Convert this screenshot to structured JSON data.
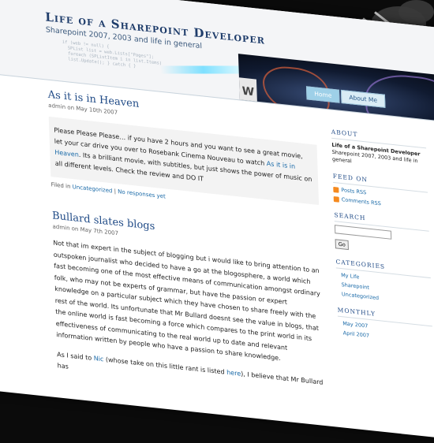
{
  "blog": {
    "title": "Life of a Sharepoint Developer",
    "subtitle": "Sharepoint 2007, 2003 and life in general"
  },
  "nav": {
    "home": "Home",
    "about": "About Me"
  },
  "posts": [
    {
      "title": "As it is in Heaven",
      "meta": "admin on May 10th 2007",
      "body_pre": "Please Please Please… if you have 2 hours and you want to see a great movie, let your car drive you over to Rosebank Cinema Nouveau to watch ",
      "body_link": "As it is in Heaven",
      "body_post": ". Its a brilliant movie, with subtitles, but just shows the power of music on all different levels. Check the review and DO IT",
      "filed_prefix": "Filed in",
      "filed_cat": "Uncategorized",
      "filed_sep": "|",
      "responses": "No responses yet"
    },
    {
      "title": "Bullard slates blogs",
      "meta": "admin on May 7th 2007",
      "para1": "Not that im expert in the subject of blogging but i would like to bring attention to an outspoken journalist who decided to have a go at the blogosphere, a world which fast becoming one of the most effective means of communication amongst ordinary folk, who may not be experts of grammar, but have the passion or expert knowledge on a particular subject which they have chosen to share freely with the rest of the world. Its unfortunate that Mr Bullard doesnt see the value in blogs, that the online world is fast becoming a force which compares to the print world in its effectiveness of communicating to the real world up to date and relevant information written by people who have a passion to share knowledge.",
      "para2_pre": "As I said to ",
      "para2_link1": "Nic",
      "para2_mid": " (whose take on this little rant is listed ",
      "para2_link2": "here",
      "para2_post": "), I believe that Mr Bullard has"
    }
  ],
  "sidebar": {
    "about_h": "About",
    "about_title": "Life of a Sharepoint Developer",
    "about_text": "Sharepoint 2007, 2003 and life in general",
    "feed_h": "Feed on",
    "posts_rss": "Posts RSS",
    "comments_rss": "Comments RSS",
    "search_h": "Search",
    "go": "Go",
    "categories_h": "Categories",
    "categories": [
      "My Life",
      "Sharepoint",
      "Uncategorized"
    ],
    "monthly_h": "Monthly",
    "months": [
      "May 2007",
      "April 2007"
    ]
  },
  "header_art": {
    "w_letter": "W"
  },
  "colors": {
    "accent": "#1f4a86",
    "link": "#1a6aa8",
    "rss": "#f58a1f",
    "background": "#0b0b0b"
  }
}
